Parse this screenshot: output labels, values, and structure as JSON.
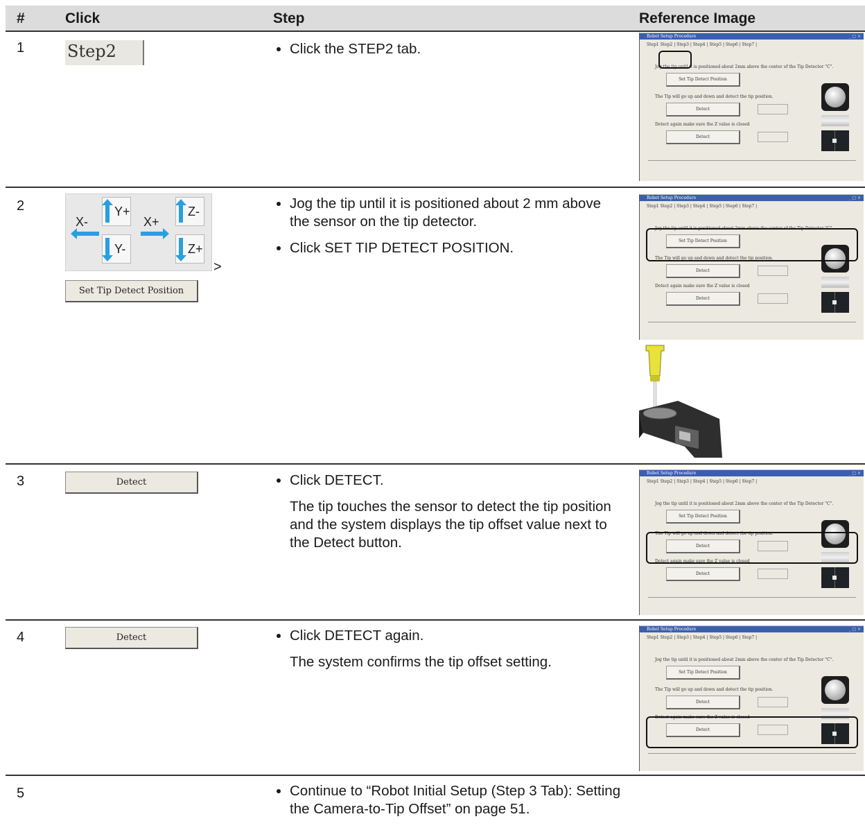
{
  "header": {
    "col_num": "#",
    "col_click": "Click",
    "col_step": "Step",
    "col_ref": "Reference Image"
  },
  "rows": [
    {
      "num": "1",
      "click_tab": "Step2",
      "bullets": [
        "Click the STEP2 tab."
      ]
    },
    {
      "num": "2",
      "jog_buttons": {
        "xminus": "X-",
        "yplus": "Y+",
        "xplus": "X+",
        "zminus": "Z-",
        "yminus": "Y-",
        "zplus": "Z+"
      },
      "arrow": ">",
      "click_button": "Set Tip Detect Position",
      "bullets": [
        "Jog the tip until it is positioned about 2 mm above the sensor on the tip detector.",
        "Click SET TIP DETECT POSITION."
      ]
    },
    {
      "num": "3",
      "click_button": "Detect",
      "bullets": [
        "Click DETECT."
      ],
      "note": "The tip touches the sensor to detect the tip position and the system displays the tip offset value next to the Detect button."
    },
    {
      "num": "4",
      "click_button": "Detect",
      "bullets": [
        "Click DETECT again."
      ],
      "note": "The system confirms the tip offset setting."
    },
    {
      "num": "5",
      "bullets": [
        "Continue to “Robot Initial Setup (Step 3 Tab): Setting the Camera-to-Tip Offset” on page 51."
      ]
    }
  ],
  "ref_window": {
    "title": "Robot Setup Procedure",
    "controls": "_ □ ×",
    "tabs": "Step1  Step2 | Step3 | Step4 | Step5 | Step6 | Step7 |",
    "line1": "Jog the tip until it is positioned about 2mm above the center of the Tip Detector \"C\".",
    "btn1": "Set Tip Detect Position",
    "line2": "The Tip will go up and down and detect the tip position.",
    "btn2": "Detect",
    "line3": "Detect again make sure the Z value is closed",
    "btn3": "Detect"
  },
  "colors": {
    "accent_blue": "#2a9fe0",
    "header_bg": "#dcdcdc"
  }
}
